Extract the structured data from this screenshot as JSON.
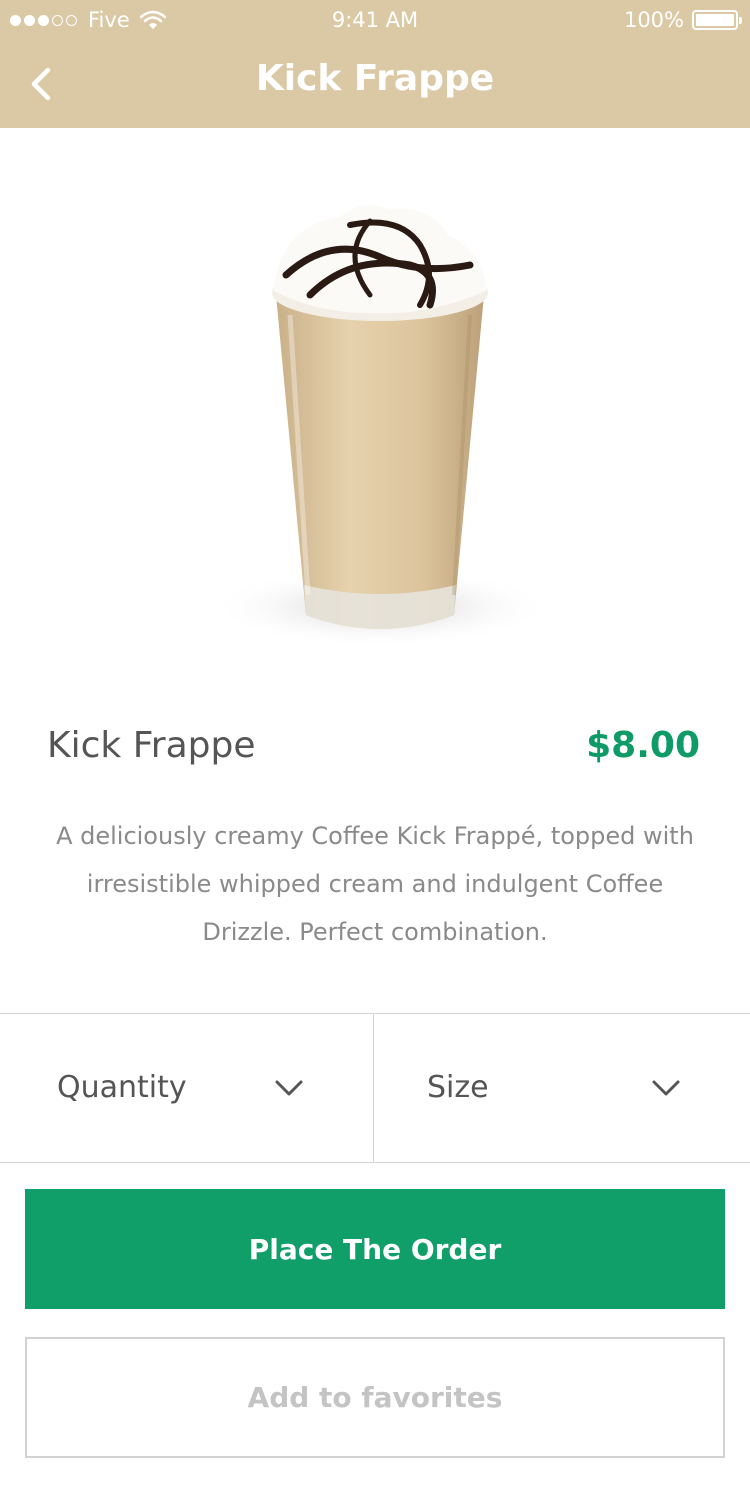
{
  "status_bar": {
    "carrier": "Five",
    "time": "9:41 AM",
    "battery": "100%"
  },
  "nav": {
    "title": "Kick Frappe",
    "back_icon": "chevron-left-icon"
  },
  "product": {
    "image": "kick-frappe-drink-image",
    "name": "Kick Frappe",
    "price": "$8.00",
    "description": "A deliciously creamy Coffee Kick Frappé, topped with irresistible whipped cream and indulgent Coffee Drizzle. Perfect combination."
  },
  "options": {
    "quantity_label": "Quantity",
    "size_label": "Size",
    "dropdown_icon": "chevron-down-icon"
  },
  "actions": {
    "order_label": "Place The Order",
    "favorites_label": "Add to favorites"
  },
  "colors": {
    "header": "#dbc9a6",
    "accent": "#109e69",
    "price": "#0f9b68"
  }
}
